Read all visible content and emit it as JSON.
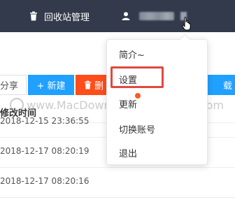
{
  "header": {
    "nav_recycle_label": "回收站管理"
  },
  "toolbar": {
    "share_label": "分享",
    "new_label": "+ 新建",
    "delete_label": "删",
    "download_label": "载"
  },
  "table": {
    "column_header": "修改时间",
    "rows": [
      {
        "time": "2018-12-15 23:36:55"
      },
      {
        "time": "2018-12-17 08:20:19"
      },
      {
        "time": "2018-12-17 08:20:16"
      }
    ]
  },
  "user_menu": {
    "items": [
      {
        "label": "简介~"
      },
      {
        "label": "设置"
      },
      {
        "label": "更新"
      },
      {
        "label": "切换账号"
      },
      {
        "label": "退出"
      }
    ]
  },
  "watermark": "www.MacDown.com MacDown.com",
  "colors": {
    "topbar": "#323a4b",
    "primary": "#20a0ff",
    "danger": "#ff4d1c",
    "highlight": "#e0493f"
  }
}
